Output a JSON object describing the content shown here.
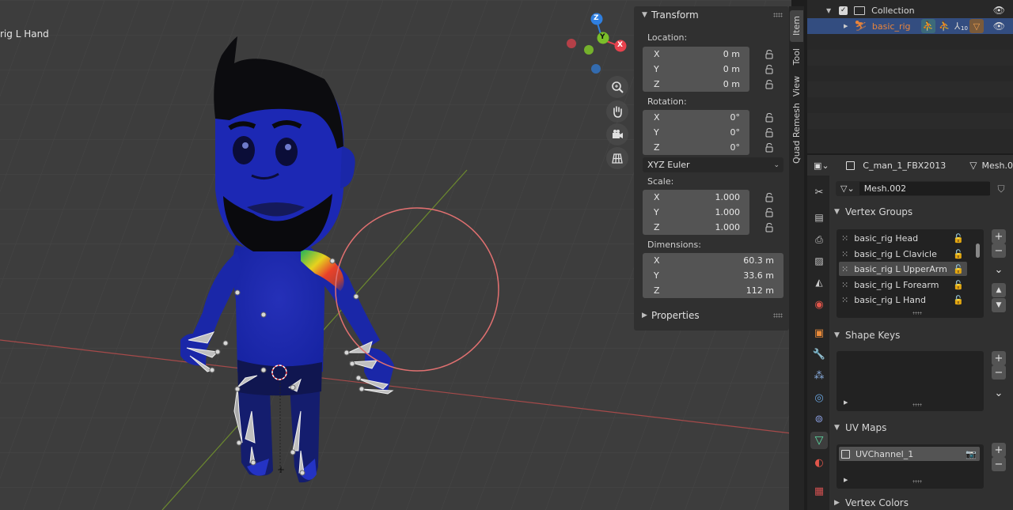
{
  "viewport": {
    "active_bone_label": "rig L Hand",
    "gizmo": {
      "z_label": "Z",
      "y_label": "Y",
      "x_label": "X"
    },
    "nav_buttons": [
      "zoom-icon",
      "hand-pan-icon",
      "camera-icon",
      "grid-icon"
    ]
  },
  "npanel": {
    "tabs": [
      "Item",
      "Tool",
      "View",
      "Quad Remesh"
    ],
    "transform": {
      "title": "Transform",
      "location_label": "Location:",
      "location": [
        {
          "axis": "X",
          "value": "0 m"
        },
        {
          "axis": "Y",
          "value": "0 m"
        },
        {
          "axis": "Z",
          "value": "0 m"
        }
      ],
      "rotation_label": "Rotation:",
      "rotation": [
        {
          "axis": "X",
          "value": "0°"
        },
        {
          "axis": "Y",
          "value": "0°"
        },
        {
          "axis": "Z",
          "value": "0°"
        }
      ],
      "rotation_mode": "XYZ Euler",
      "scale_label": "Scale:",
      "scale": [
        {
          "axis": "X",
          "value": "1.000"
        },
        {
          "axis": "Y",
          "value": "1.000"
        },
        {
          "axis": "Z",
          "value": "1.000"
        }
      ],
      "dimensions_label": "Dimensions:",
      "dimensions": [
        {
          "axis": "X",
          "value": "60.3 m"
        },
        {
          "axis": "Y",
          "value": "33.6 m"
        },
        {
          "axis": "Z",
          "value": "112 m"
        }
      ]
    },
    "properties_title": "Properties"
  },
  "outliner": {
    "collection": "Collection",
    "rig": "basic_rig",
    "rig_badge_count": "10"
  },
  "properties": {
    "object_name": "C_man_1_FBX2013",
    "mesh_name_header": "Mesh.0",
    "mesh_datablock": "Mesh.002",
    "vertex_groups_title": "Vertex Groups",
    "vertex_groups": [
      "basic_rig Head",
      "basic_rig L Clavicle",
      "basic_rig L UpperArm",
      "basic_rig L Forearm",
      "basic_rig L Hand"
    ],
    "selected_vertex_group": 2,
    "shape_keys_title": "Shape Keys",
    "uv_maps_title": "UV Maps",
    "uv_maps": [
      "UVChannel_1"
    ],
    "vertex_colors_title": "Vertex Colors"
  },
  "colors": {
    "viewport_bg": "#3d3d3d",
    "selection_blue": "#334d80",
    "gizmo_x": "#e8424d",
    "gizmo_y": "#7bbe2a",
    "gizmo_z": "#2f7fe0",
    "brush_circle": "#e07070"
  }
}
